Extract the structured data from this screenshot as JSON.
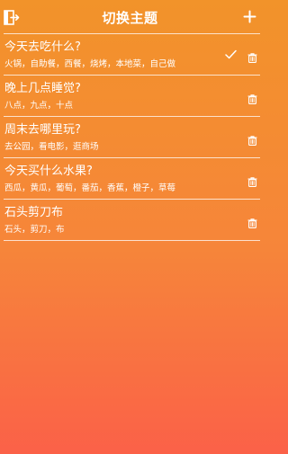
{
  "header": {
    "title": "切换主题",
    "exit_icon": "exit-door-icon",
    "add_icon": "plus-icon"
  },
  "themes": [
    {
      "title": "今天去吃什么?",
      "options": "火锅，自助餐，西餐，烧烤，本地菜，自己做",
      "selected": true
    },
    {
      "title": "晚上几点睡觉?",
      "options": "八点，九点，十点",
      "selected": false
    },
    {
      "title": "周末去哪里玩?",
      "options": "去公园，看电影，逛商场",
      "selected": false
    },
    {
      "title": "今天买什么水果?",
      "options": "西瓜，黄瓜，葡萄，番茄，香蕉，橙子，草莓",
      "selected": false
    },
    {
      "title": "石头剪刀布",
      "options": "石头，剪刀，布",
      "selected": false
    }
  ],
  "colors": {
    "gradient_top": "#f2932a",
    "gradient_bottom": "#fb6148",
    "text": "#ffffff"
  }
}
